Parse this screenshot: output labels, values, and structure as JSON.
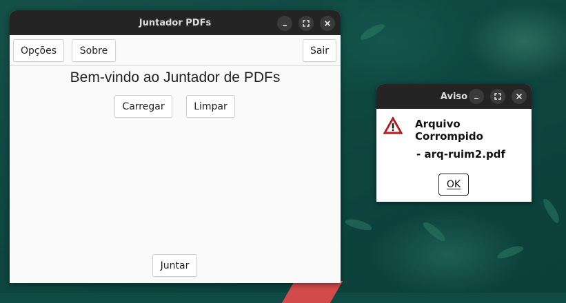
{
  "main_window": {
    "title": "Juntador PDFs",
    "menu": {
      "options_label": "Opções",
      "about_label": "Sobre",
      "exit_label": "Sair"
    },
    "welcome_text": "Bem-vindo ao Juntador de PDFs",
    "load_label": "Carregar",
    "clear_label": "Limpar",
    "merge_label": "Juntar"
  },
  "dialog": {
    "title": "Aviso",
    "heading": "Arquivo Corrompido",
    "file_text": "- arq-ruim2.pdf",
    "ok_label": "OK",
    "icon": "warning-icon"
  },
  "colors": {
    "titlebar": "#242424",
    "window_bg": "#fafafa",
    "warning_red": "#cc1f1f",
    "desktop": "#0f4a44"
  }
}
